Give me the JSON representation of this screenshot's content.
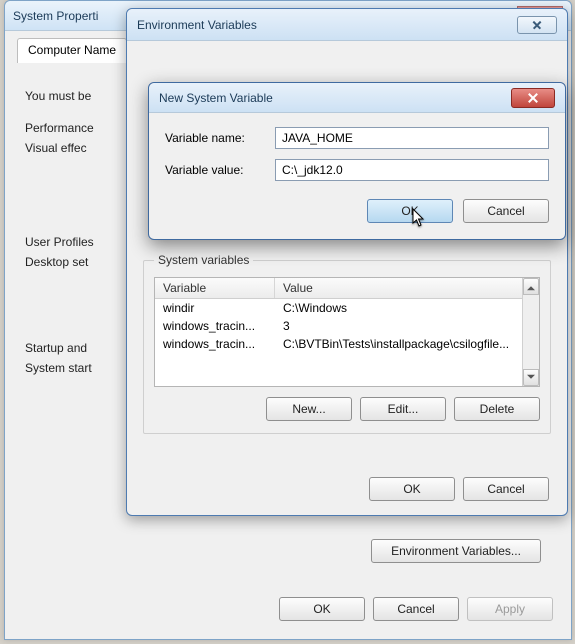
{
  "sysprops": {
    "title": "System Properti",
    "tab_label": "Computer Name",
    "lead": "You must be",
    "perf_hdr": "Performance",
    "perf_desc": "Visual effec",
    "profiles_hdr": "User Profiles",
    "profiles_desc": "Desktop set",
    "startup_hdr": "Startup and",
    "startup_desc": "System start",
    "env_btn": "Environment Variables...",
    "ok": "OK",
    "cancel": "Cancel",
    "apply": "Apply"
  },
  "env": {
    "title": "Environment Variables",
    "sys_legend": "System variables",
    "col_var": "Variable",
    "col_val": "Value",
    "rows": [
      {
        "variable": "windir",
        "value": "C:\\Windows"
      },
      {
        "variable": "windows_tracin...",
        "value": "3"
      },
      {
        "variable": "windows_tracin...",
        "value": "C:\\BVTBin\\Tests\\installpackage\\csilogfile..."
      }
    ],
    "new": "New...",
    "edit": "Edit...",
    "delete": "Delete",
    "ok": "OK",
    "cancel": "Cancel"
  },
  "newvar": {
    "title": "New System Variable",
    "name_label": "Variable name:",
    "name_value": "JAVA_HOME",
    "value_label": "Variable value:",
    "value_value": "C:\\_jdk12.0",
    "ok": "OK",
    "cancel": "Cancel"
  }
}
